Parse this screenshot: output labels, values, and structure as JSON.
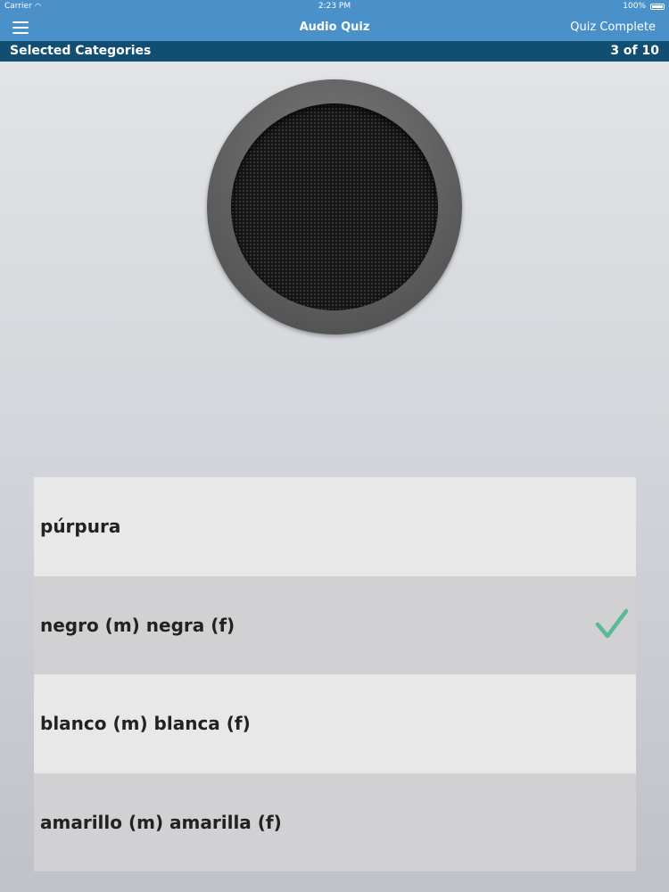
{
  "status_bar": {
    "carrier": "Carrier",
    "time": "2:23 PM",
    "battery": "100%"
  },
  "nav": {
    "title": "Audio Quiz",
    "action_label": "Quiz Complete",
    "menu_icon": "hamburger-menu-icon"
  },
  "category_bar": {
    "label": "Selected Categories",
    "progress": "3 of 10"
  },
  "speaker": {
    "icon": "speaker-play-icon"
  },
  "answers": [
    {
      "text": "púrpura",
      "correct": false
    },
    {
      "text": "negro (m)  negra (f)",
      "correct": true
    },
    {
      "text": "blanco (m)  blanca (f)",
      "correct": false
    },
    {
      "text": "amarillo (m)  amarilla (f)",
      "correct": false
    }
  ],
  "colors": {
    "nav_blue": "#4a90c9",
    "category_bar": "#124e72",
    "check_green": "#5db898"
  }
}
